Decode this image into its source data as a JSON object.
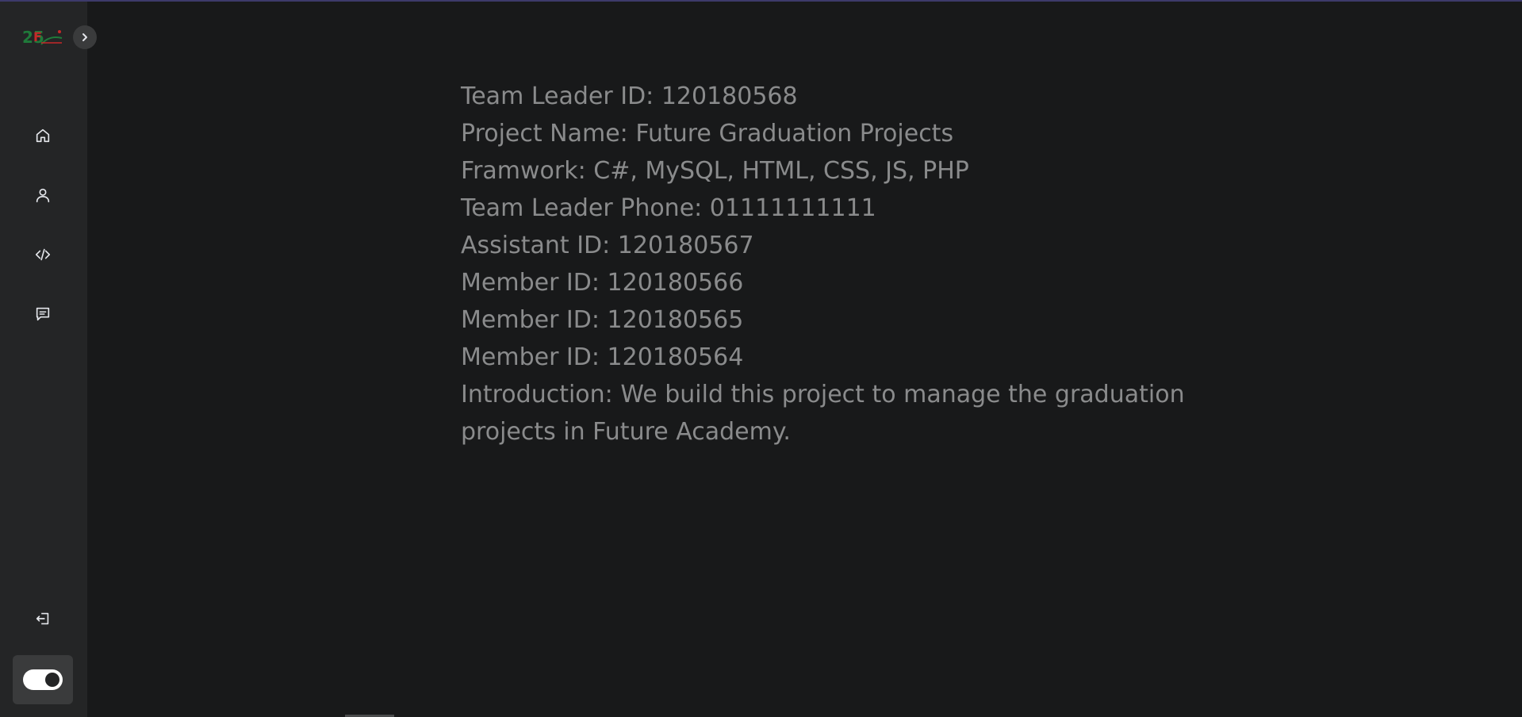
{
  "app": {
    "accent_line_color": "#3d3a6b",
    "sidebar_bg": "#242526",
    "main_bg": "#18191a"
  },
  "sidebar": {
    "logo_text": "25",
    "expand_icon": "chevron-right-icon",
    "nav_items": [
      {
        "icon": "home-icon"
      },
      {
        "icon": "user-icon"
      },
      {
        "icon": "code-icon"
      },
      {
        "icon": "message-icon"
      }
    ],
    "logout_icon": "logout-icon",
    "theme_toggle": "on"
  },
  "project": {
    "team_leader_id": "Team Leader ID: 120180568",
    "project_name": "Project Name: Future Graduation Projects",
    "framework": "Framwork: C#, MySQL, HTML, CSS, JS, PHP",
    "team_leader_phone": "Team Leader Phone: 01111111111",
    "assistant_id": "Assistant ID: 120180567",
    "member_1": "Member ID: 120180566",
    "member_2": "Member ID: 120180565",
    "member_3": "Member ID: 120180564",
    "introduction": "Introduction: We build this project to manage the graduation projects in Future Academy."
  }
}
